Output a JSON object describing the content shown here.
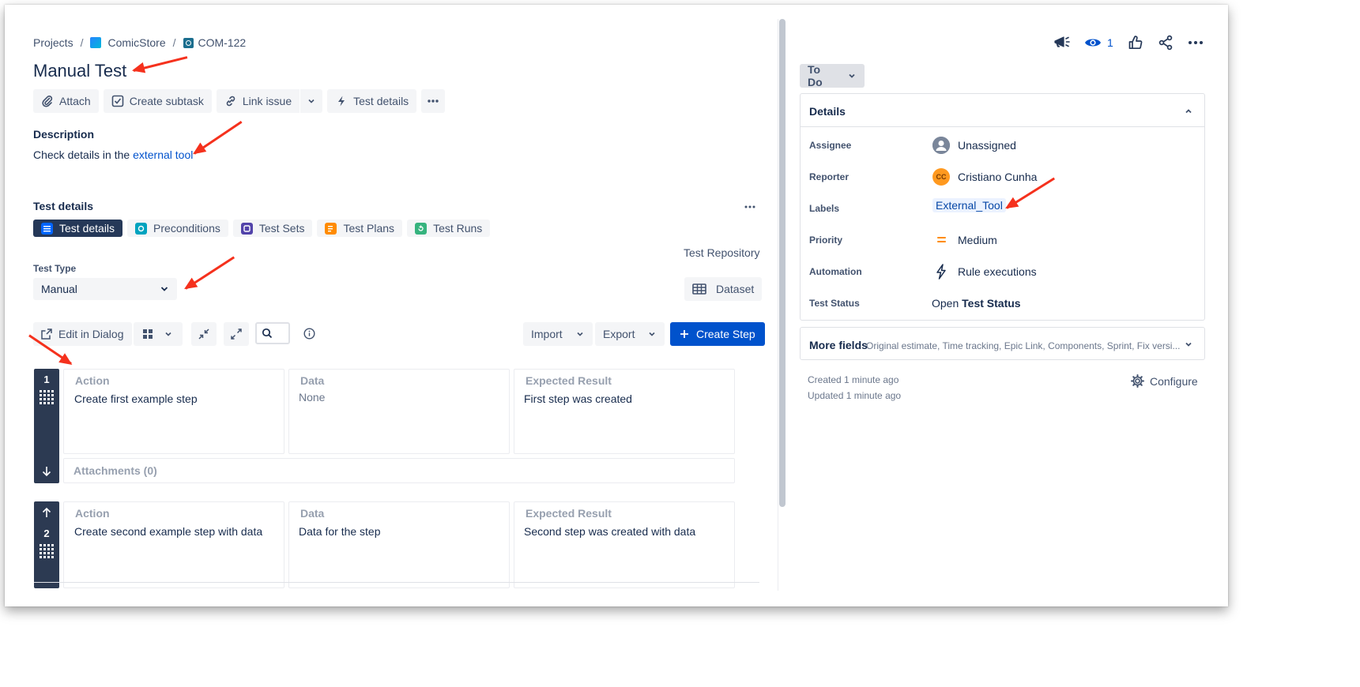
{
  "breadcrumb": {
    "projects": "Projects",
    "separator": "/",
    "project": "ComicStore",
    "issue_key": "COM-122"
  },
  "issue": {
    "title": "Manual Test"
  },
  "toolbar": {
    "attach": "Attach",
    "create_subtask": "Create subtask",
    "link_issue": "Link issue",
    "test_details": "Test details"
  },
  "description": {
    "heading": "Description",
    "text_prefix": "Check details in the ",
    "link_text": "external tool"
  },
  "test_details": {
    "heading": "Test details",
    "tabs": [
      "Test details",
      "Preconditions",
      "Test Sets",
      "Test Plans",
      "Test Runs"
    ],
    "active_tab": 0,
    "repository_link": "Test Repository",
    "test_type_label": "Test Type",
    "test_type_value": "Manual",
    "dataset_button": "Dataset",
    "steps_toolbar": {
      "edit_in_dialog": "Edit in Dialog",
      "import": "Import",
      "export": "Export",
      "create_step": "Create Step"
    },
    "columns": {
      "action": "Action",
      "data": "Data",
      "expected": "Expected Result"
    },
    "steps": [
      {
        "number": "1",
        "action": "Create first example step",
        "data": "None",
        "expected": "First step was created",
        "attachments": "Attachments (0)"
      },
      {
        "number": "2",
        "action": "Create second example step with data",
        "data": "Data for the step",
        "expected": "Second step was created with data"
      }
    ]
  },
  "header_actions": {
    "watchers": "1"
  },
  "status": {
    "label": "To Do"
  },
  "details": {
    "heading": "Details",
    "fields": [
      {
        "label": "Assignee",
        "value": "Unassigned"
      },
      {
        "label": "Reporter",
        "value": "Cristiano Cunha",
        "initials": "CC"
      },
      {
        "label": "Labels",
        "value": "External_Tool"
      },
      {
        "label": "Priority",
        "value": "Medium"
      },
      {
        "label": "Automation",
        "value": "Rule executions"
      },
      {
        "label": "Test Status",
        "value_prefix": "Open ",
        "value_bold": "Test Status"
      }
    ]
  },
  "more_fields": {
    "label": "More fields",
    "hint": "Original estimate, Time tracking, Epic Link, Components, Sprint, Fix versi..."
  },
  "footer": {
    "created": "Created 1 minute ago",
    "updated": "Updated 1 minute ago",
    "configure": "Configure"
  },
  "colors": {
    "primary": "#0052cc",
    "dark": "#253858",
    "annotation": "#f5311d",
    "priority_medium": "#ff8b00"
  }
}
